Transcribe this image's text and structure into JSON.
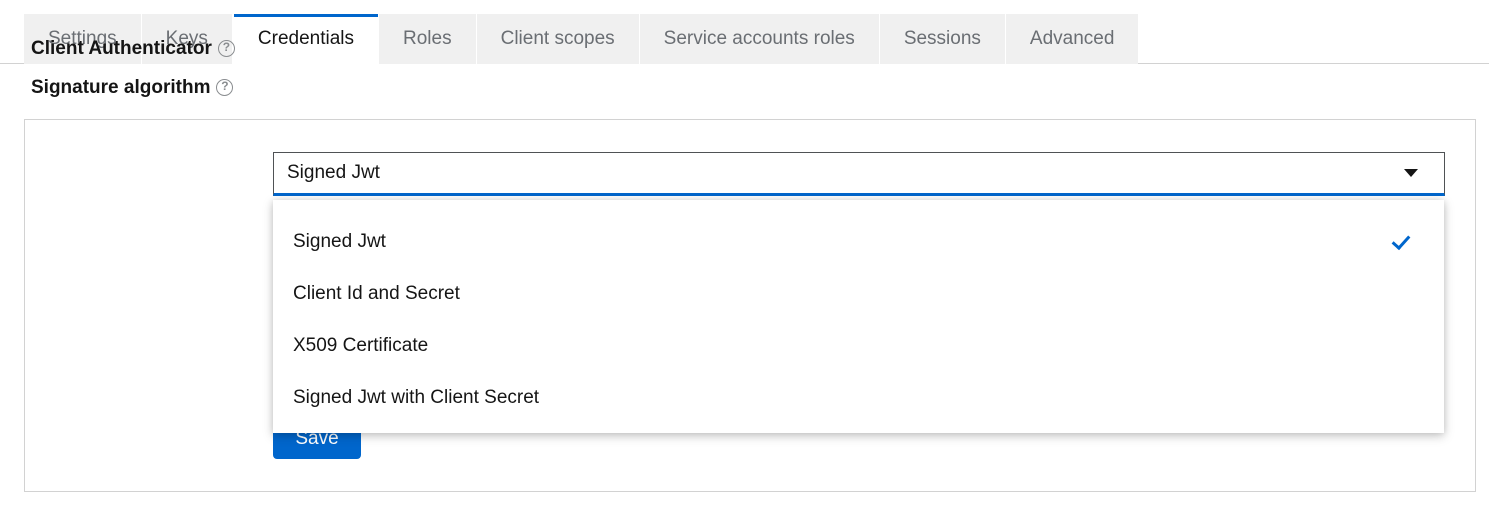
{
  "tabs": [
    {
      "label": "Settings",
      "active": false
    },
    {
      "label": "Keys",
      "active": false
    },
    {
      "label": "Credentials",
      "active": true
    },
    {
      "label": "Roles",
      "active": false
    },
    {
      "label": "Client scopes",
      "active": false
    },
    {
      "label": "Service accounts roles",
      "active": false
    },
    {
      "label": "Sessions",
      "active": false
    },
    {
      "label": "Advanced",
      "active": false
    }
  ],
  "form": {
    "client_authenticator_label": "Client Authenticator",
    "signature_algorithm_label": "Signature algorithm",
    "help_icon": "question-circle-icon"
  },
  "select": {
    "value": "Signed Jwt",
    "expanded": true,
    "caret_icon": "caret-down-icon",
    "check_icon": "check-icon",
    "options": [
      {
        "label": "Signed Jwt",
        "selected": true
      },
      {
        "label": "Client Id and Secret",
        "selected": false
      },
      {
        "label": "X509 Certificate",
        "selected": false
      },
      {
        "label": "Signed Jwt with Client Secret",
        "selected": false
      }
    ]
  },
  "actions": {
    "save_label": "Save"
  },
  "colors": {
    "accent": "#0066cc",
    "tab_inactive_bg": "#f0f0f0",
    "text": "#151515",
    "muted_text": "#6a6e73",
    "border": "#d2d2d2"
  }
}
